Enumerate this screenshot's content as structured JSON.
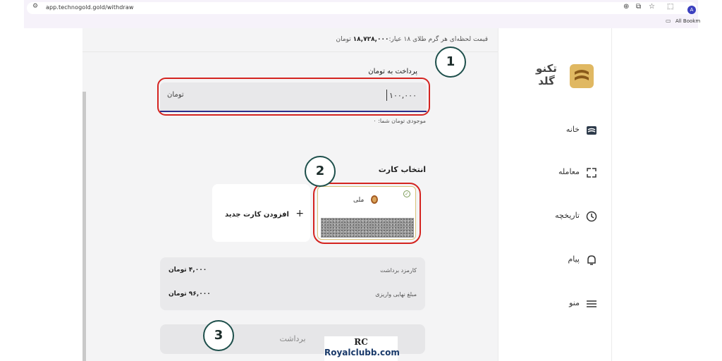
{
  "browser": {
    "url": "app.technogold.gold/withdraw",
    "bookmarks_label": "All Bookm",
    "profile_initial": "A"
  },
  "price_bar": {
    "label": "قیمت لحظه‌ای هر گرم طلای ۱۸ عیار:",
    "value": "۱۸,۷۲۸,۰۰۰",
    "unit": "تومان"
  },
  "payment": {
    "label": "پرداخت به تومان",
    "amount_value": "۱۰۰,۰۰۰",
    "amount_unit": "تومان",
    "balance_text": "موجودی تومان شما: ۰"
  },
  "cards": {
    "title": "انتخاب کارت",
    "add_card_label": "افزودن کارت جدید",
    "add_icon": "plus-icon",
    "selected_card": {
      "bank": "ملی",
      "selected": true
    }
  },
  "fees": {
    "withdraw_fee_label": "کارمزد برداشت",
    "withdraw_fee_value": "۴,۰۰۰ تومان",
    "final_amount_label": "مبلغ نهایی واریزی",
    "final_amount_value": "۹۶,۰۰۰ تومان"
  },
  "withdraw_button": "برداشت",
  "steps": [
    "1",
    "2",
    "3"
  ],
  "watermark": {
    "mark": "RC",
    "text": "Royalclubb.com"
  },
  "sidebar": {
    "logo_text": "تکنو گلد",
    "items": [
      {
        "label": "خانه",
        "icon": "home-icon"
      },
      {
        "label": "معامله",
        "icon": "exchange-icon"
      },
      {
        "label": "تاریخچه",
        "icon": "history-icon"
      },
      {
        "label": "پیام",
        "icon": "bell-icon"
      },
      {
        "label": "منو",
        "icon": "menu-icon"
      }
    ]
  },
  "colors": {
    "highlight_ring": "#d42420",
    "step_border": "#1d4f4b",
    "brand_gold": "#c9a24a",
    "input_underline": "#2d2d8a"
  }
}
